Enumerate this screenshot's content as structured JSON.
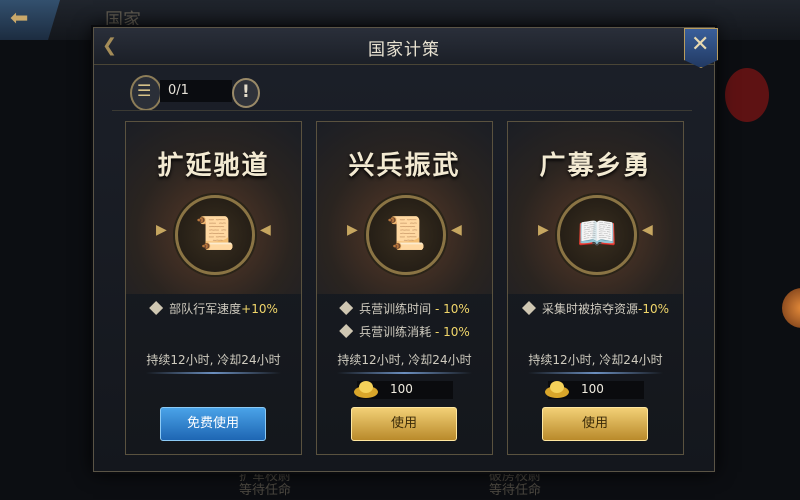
{
  "background": {
    "back_icon": "back-arrow-icon",
    "title": "国家",
    "footer_left": [
      "扩军校尉",
      "等待任命"
    ],
    "footer_right": [
      "破房校尉",
      "等待任命"
    ]
  },
  "dialog": {
    "title": "国家计策",
    "close_icon": "close-cross-icon",
    "counter": "0/1",
    "info_icon": "exclamation-icon"
  },
  "cards": [
    {
      "title": "扩延驰道",
      "icon": "scroll-map-icon",
      "effects": [
        {
          "label": "部队行军速度",
          "value": "+10%"
        }
      ],
      "duration": "持续12小时, 冷却24小时",
      "button": "免费使用",
      "button_style": "blue"
    },
    {
      "title": "兴兵振武",
      "icon": "scroll-book-icon",
      "effects": [
        {
          "label": "兵营训练时间",
          "value": " - 10%"
        },
        {
          "label": "兵营训练消耗",
          "value": " - 10%"
        }
      ],
      "duration": "持续12小时, 冷却24小时",
      "cost": "100",
      "button": "使用",
      "button_style": "gold"
    },
    {
      "title": "广募乡勇",
      "icon": "open-book-icon",
      "effects": [
        {
          "label": "采集时被掠夺资源",
          "value": "-10%"
        }
      ],
      "duration": "持续12小时, 冷却24小时",
      "cost": "100",
      "button": "使用",
      "button_style": "gold"
    }
  ],
  "colors": {
    "accent_gold": "#f0d66a",
    "button_blue": "#1e66b3",
    "button_gold": "#b98a2b"
  }
}
